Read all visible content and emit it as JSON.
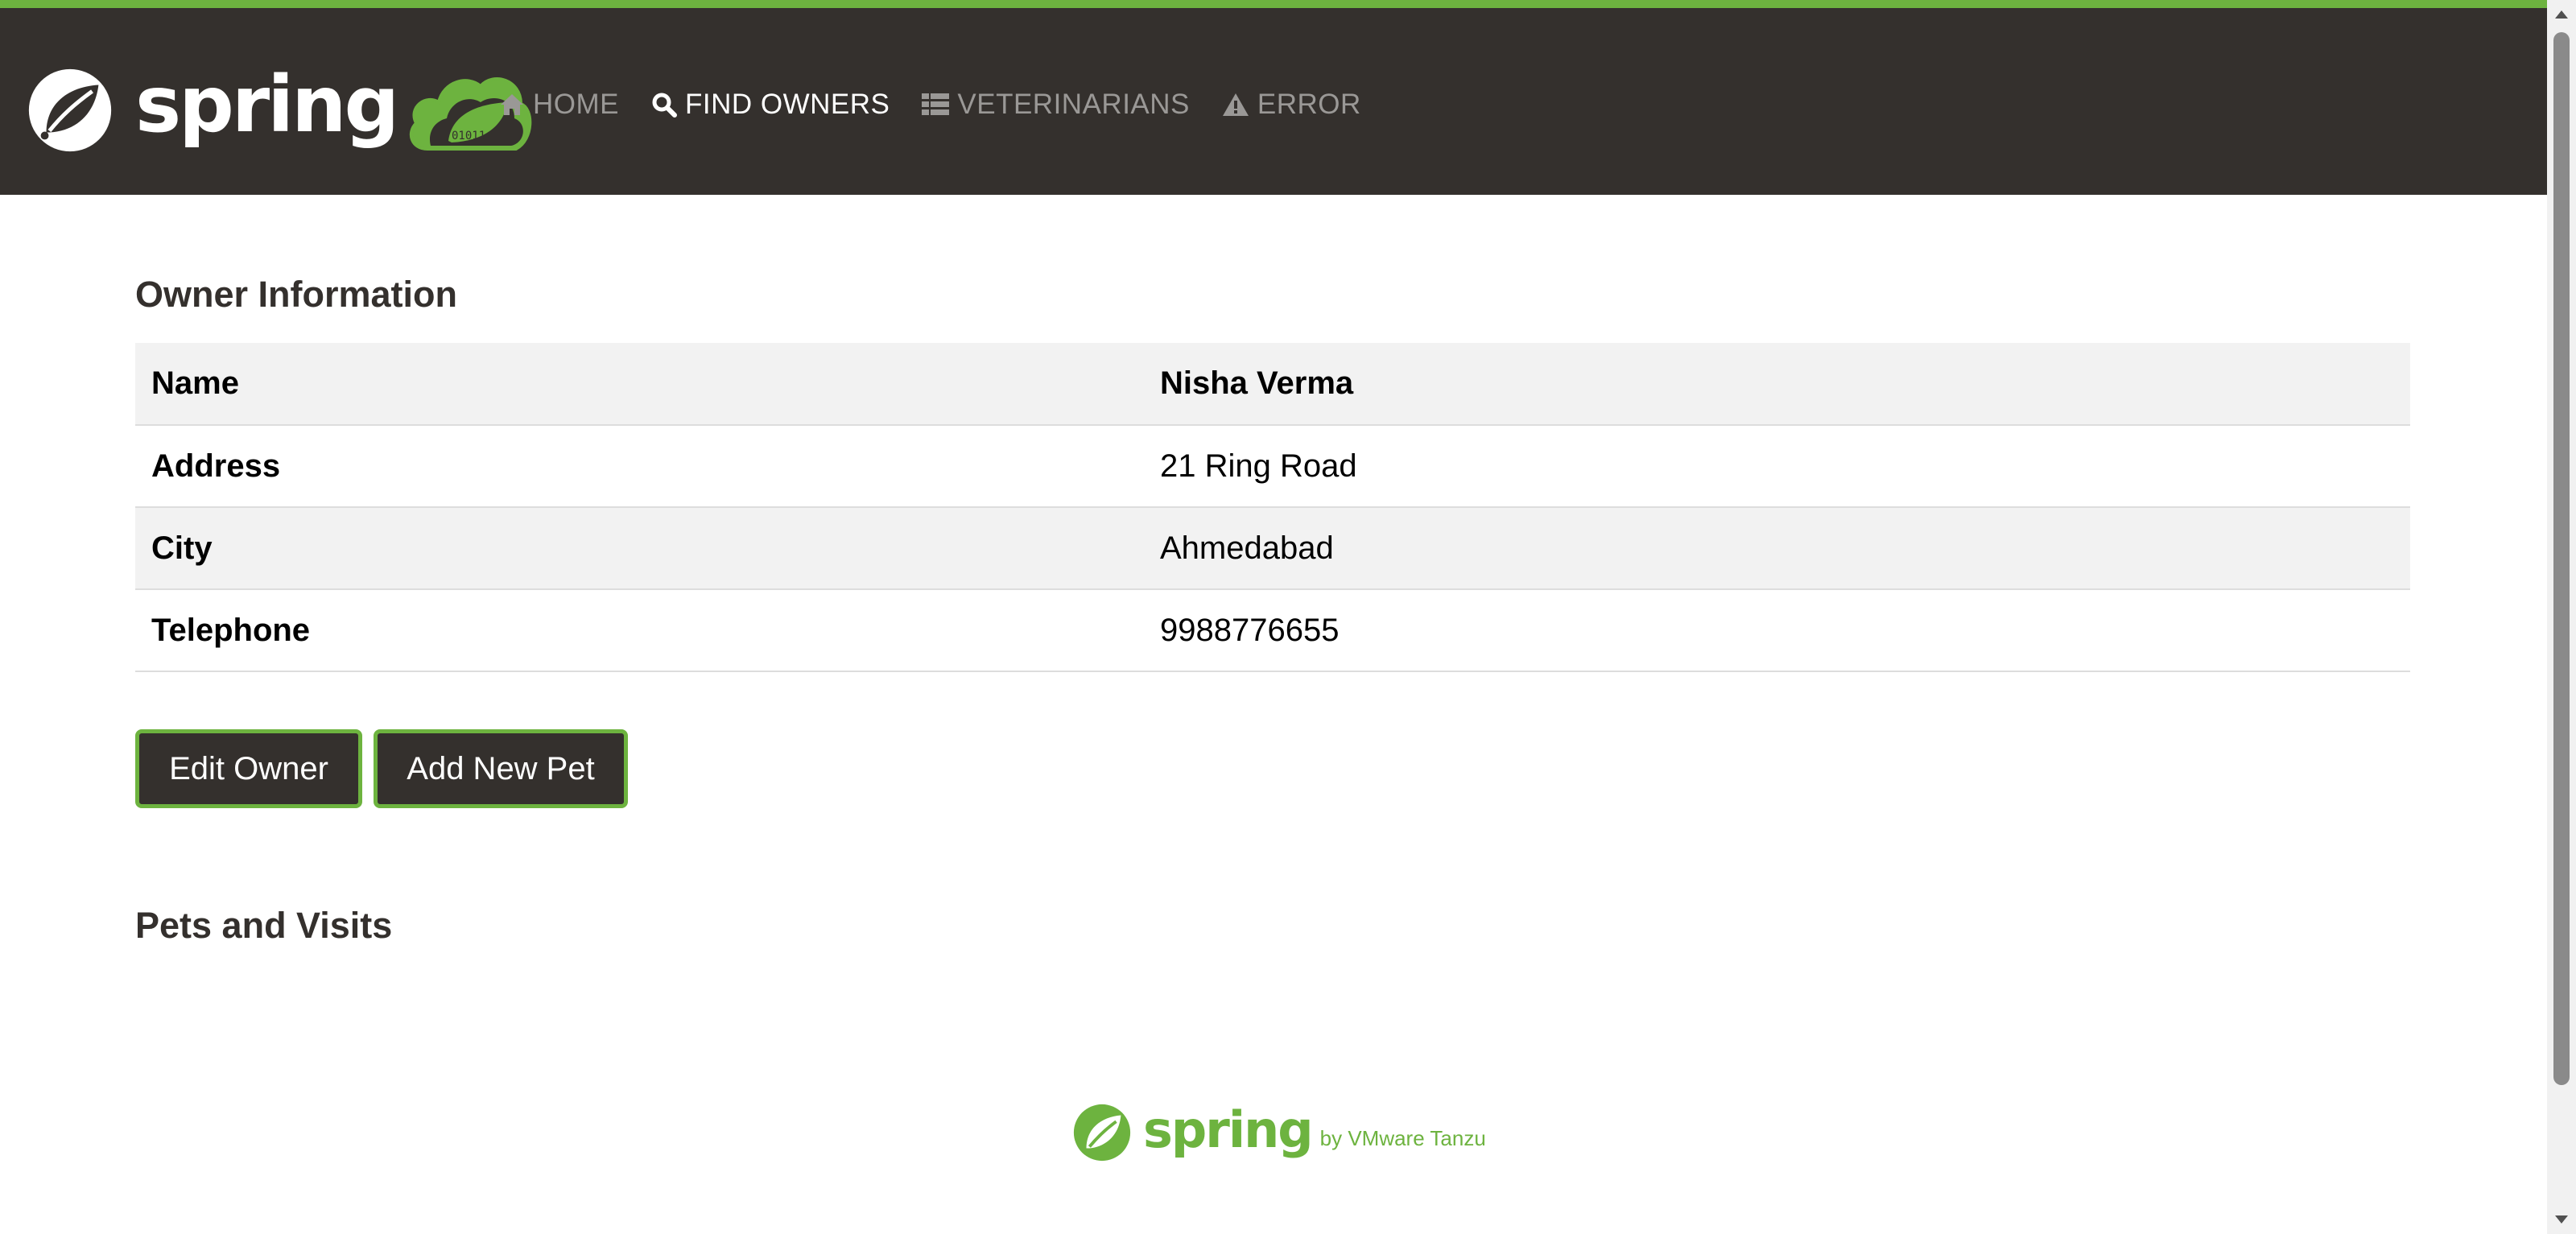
{
  "brand": {
    "name": "spring"
  },
  "nav": {
    "items": [
      {
        "label": "HOME",
        "icon": "home-icon",
        "active": false
      },
      {
        "label": "FIND OWNERS",
        "icon": "search-icon",
        "active": true
      },
      {
        "label": "VETERINARIANS",
        "icon": "list-icon",
        "active": false
      },
      {
        "label": "ERROR",
        "icon": "warning-icon",
        "active": false
      }
    ]
  },
  "owner": {
    "heading": "Owner Information",
    "rows": [
      {
        "label": "Name",
        "value": "Nisha Verma"
      },
      {
        "label": "Address",
        "value": "21 Ring Road"
      },
      {
        "label": "City",
        "value": "Ahmedabad"
      },
      {
        "label": "Telephone",
        "value": "9988776655"
      }
    ]
  },
  "actions": {
    "edit_label": "Edit Owner",
    "add_pet_label": "Add New Pet"
  },
  "pets": {
    "heading": "Pets and Visits"
  },
  "footer": {
    "brand": "spring",
    "tagline": "by VMware Tanzu"
  },
  "colors": {
    "brand_green": "#6db33f",
    "nav_bg": "#34302d",
    "row_alt": "#f2f2f2"
  }
}
